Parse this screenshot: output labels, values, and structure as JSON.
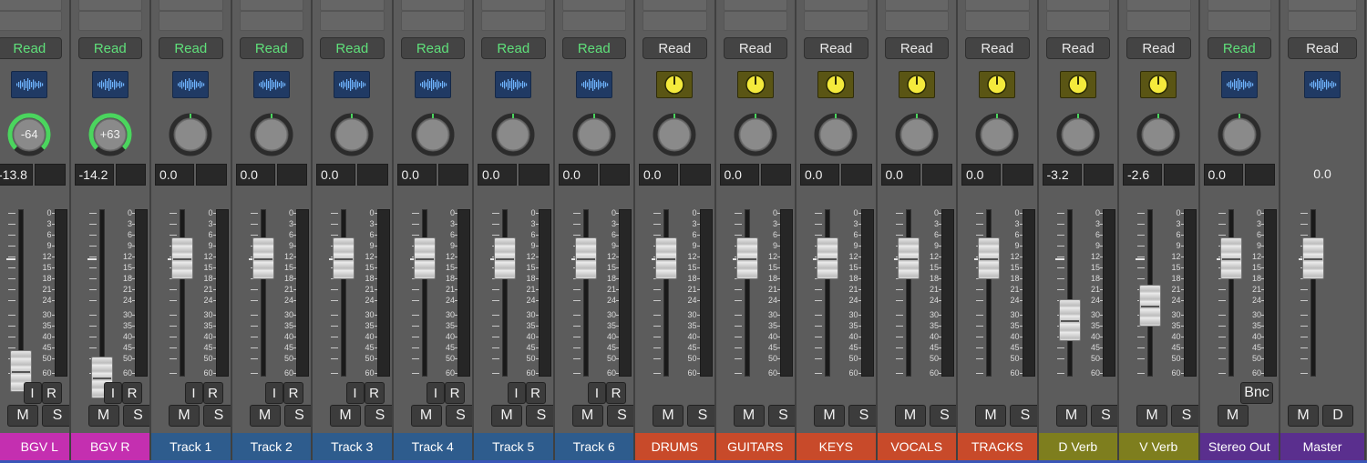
{
  "colors": {
    "pink": "#c42fb0",
    "blue": "#2e5c8d",
    "orange": "#c84a2a",
    "olive": "#7e7e1e",
    "purple": "#5a2f8e",
    "read_green": "#5fe07a",
    "pan_green": "#4bd55e"
  },
  "scale": [
    "0",
    "3",
    "6",
    "9",
    "12",
    "15",
    "18",
    "21",
    "24",
    "30",
    "35",
    "40",
    "45",
    "50",
    "60"
  ],
  "strips": [
    {
      "name": "BGV L",
      "color": "pink",
      "automation": "Read",
      "read_green": true,
      "plugin": "waveform-icon",
      "pan_value": "-64",
      "pan_ring": 0.5,
      "gain": "-13.8",
      "fader_db": -35,
      "input": "I",
      "record": "R",
      "mute": "M",
      "solo": "S"
    },
    {
      "name": "BGV R",
      "color": "pink",
      "automation": "Read",
      "read_green": true,
      "plugin": "waveform-icon",
      "pan_value": "+63",
      "pan_ring": 0.5,
      "gain": "-14.2",
      "fader_db": -38,
      "input": "I",
      "record": "R",
      "mute": "M",
      "solo": "S"
    },
    {
      "name": "Track 1",
      "color": "blue",
      "automation": "Read",
      "read_green": true,
      "plugin": "waveform-icon",
      "pan_value": "",
      "pan_ring": 0,
      "gain": "0.0",
      "fader_db": 0,
      "input": "I",
      "record": "R",
      "mute": "M",
      "solo": "S"
    },
    {
      "name": "Track 2",
      "color": "blue",
      "automation": "Read",
      "read_green": true,
      "plugin": "waveform-icon",
      "pan_value": "",
      "pan_ring": 0,
      "gain": "0.0",
      "fader_db": 0,
      "input": "I",
      "record": "R",
      "mute": "M",
      "solo": "S"
    },
    {
      "name": "Track 3",
      "color": "blue",
      "automation": "Read",
      "read_green": true,
      "plugin": "waveform-icon",
      "pan_value": "",
      "pan_ring": 0,
      "gain": "0.0",
      "fader_db": 0,
      "input": "I",
      "record": "R",
      "mute": "M",
      "solo": "S"
    },
    {
      "name": "Track 4",
      "color": "blue",
      "automation": "Read",
      "read_green": true,
      "plugin": "waveform-icon",
      "pan_value": "",
      "pan_ring": 0,
      "gain": "0.0",
      "fader_db": 0,
      "input": "I",
      "record": "R",
      "mute": "M",
      "solo": "S"
    },
    {
      "name": "Track 5",
      "color": "blue",
      "automation": "Read",
      "read_green": true,
      "plugin": "waveform-icon",
      "pan_value": "",
      "pan_ring": 0,
      "gain": "0.0",
      "fader_db": 0,
      "input": "I",
      "record": "R",
      "mute": "M",
      "solo": "S"
    },
    {
      "name": "Track 6",
      "color": "blue",
      "automation": "Read",
      "read_green": true,
      "plugin": "waveform-icon",
      "pan_value": "",
      "pan_ring": 0,
      "gain": "0.0",
      "fader_db": 0,
      "input": "I",
      "record": "R",
      "mute": "M",
      "solo": "S"
    },
    {
      "name": "DRUMS",
      "color": "orange",
      "automation": "Read",
      "read_green": false,
      "plugin": "knob-icon",
      "pan_value": "",
      "pan_ring": 0,
      "gain": "0.0",
      "fader_db": 0,
      "input": "",
      "record": "",
      "mute": "M",
      "solo": "S"
    },
    {
      "name": "GUITARS",
      "color": "orange",
      "automation": "Read",
      "read_green": false,
      "plugin": "knob-icon",
      "pan_value": "",
      "pan_ring": 0,
      "gain": "0.0",
      "fader_db": 0,
      "input": "",
      "record": "",
      "mute": "M",
      "solo": "S"
    },
    {
      "name": "KEYS",
      "color": "orange",
      "automation": "Read",
      "read_green": false,
      "plugin": "knob-icon",
      "pan_value": "",
      "pan_ring": 0,
      "gain": "0.0",
      "fader_db": 0,
      "input": "",
      "record": "",
      "mute": "M",
      "solo": "S"
    },
    {
      "name": "VOCALS",
      "color": "orange",
      "automation": "Read",
      "read_green": false,
      "plugin": "knob-icon",
      "pan_value": "",
      "pan_ring": 0,
      "gain": "0.0",
      "fader_db": 0,
      "input": "",
      "record": "",
      "mute": "M",
      "solo": "S"
    },
    {
      "name": "TRACKS",
      "color": "orange",
      "automation": "Read",
      "read_green": false,
      "plugin": "knob-icon",
      "pan_value": "",
      "pan_ring": 0,
      "gain": "0.0",
      "fader_db": 0,
      "input": "",
      "record": "",
      "mute": "M",
      "solo": "S"
    },
    {
      "name": "D Verb",
      "color": "olive",
      "automation": "Read",
      "read_green": false,
      "plugin": "knob-icon",
      "pan_value": "",
      "pan_ring": 0,
      "gain": "-3.2",
      "fader_db": -17,
      "input": "",
      "record": "",
      "mute": "M",
      "solo": "S"
    },
    {
      "name": "V Verb",
      "color": "olive",
      "automation": "Read",
      "read_green": false,
      "plugin": "knob-icon",
      "pan_value": "",
      "pan_ring": 0,
      "gain": "-2.6",
      "fader_db": -13,
      "input": "",
      "record": "",
      "mute": "M",
      "solo": "S"
    },
    {
      "name": "Stereo Out",
      "color": "purple",
      "automation": "Read",
      "read_green": true,
      "plugin": "waveform-icon",
      "pan_value": "",
      "pan_ring": 0,
      "gain": "0.0",
      "fader_db": 0,
      "input": "",
      "record": "",
      "bounce": "Bnc",
      "mute": "M",
      "solo": ""
    },
    {
      "name": "Master",
      "color": "purple",
      "automation": "Read",
      "read_green": false,
      "plugin": "waveform-icon",
      "pan_value": "",
      "pan_ring": -1,
      "gain": "0.0",
      "fader_db": 0,
      "input": "",
      "record": "",
      "mute": "M",
      "solo": "",
      "dim": "D"
    }
  ]
}
